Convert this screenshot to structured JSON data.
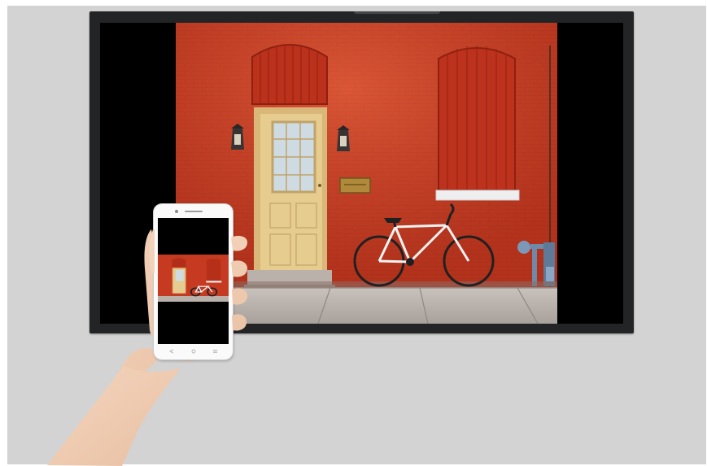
{
  "scene": {
    "subject": "",
    "colors": {
      "backdrop": "#d3d3d3",
      "tv_bezel": "#232425",
      "brick_wall": "#c83a22",
      "door": "#e2c88a",
      "skin": "#f0cdb3"
    },
    "icons": [
      "back-icon",
      "home-icon",
      "menu-icon"
    ]
  }
}
